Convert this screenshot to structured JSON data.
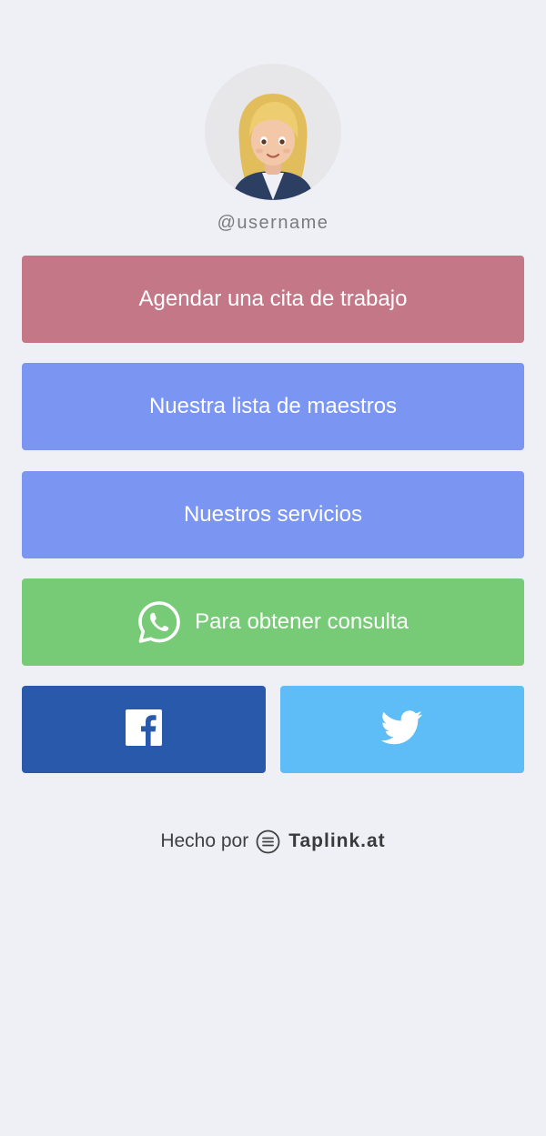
{
  "profile": {
    "avatar_icon": "woman-blond-hair-emoji",
    "username": "@username"
  },
  "buttons": [
    {
      "label": "Agendar una cita de trabajo",
      "color": "#c47887"
    },
    {
      "label": "Nuestra lista de maestros",
      "color": "#7b96f2"
    },
    {
      "label": "Nuestros servicios",
      "color": "#7b96f2"
    },
    {
      "label": "Para obtener consulta",
      "color": "#77cb76",
      "icon": "whatsapp-icon"
    }
  ],
  "social": [
    {
      "icon": "facebook-icon",
      "color": "#2959ab"
    },
    {
      "icon": "twitter-icon",
      "color": "#5ebdf7"
    }
  ],
  "footer": {
    "made_by": "Hecho por",
    "brand": "Taplink.at",
    "brand_icon": "taplink-logo-icon"
  },
  "colors": {
    "background": "#eff0f5",
    "username_text": "#7b7b7f"
  }
}
